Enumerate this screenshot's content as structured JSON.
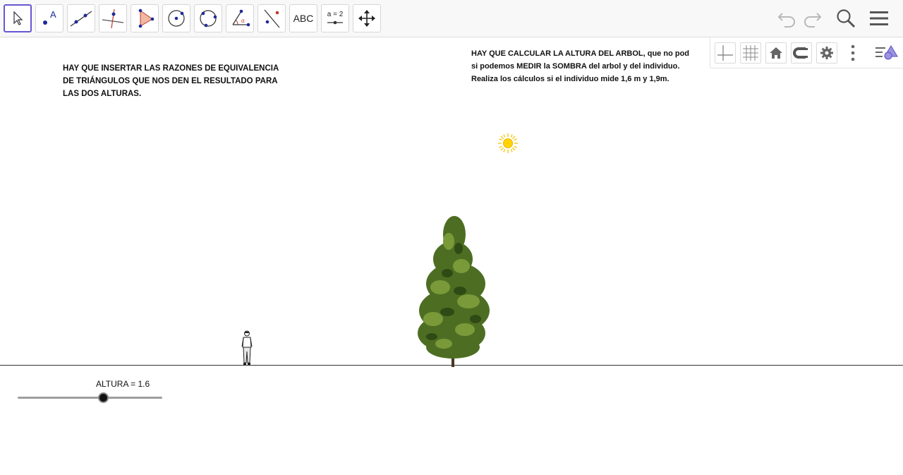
{
  "toolbar": {
    "tools": [
      {
        "name": "move-tool"
      },
      {
        "name": "point-tool"
      },
      {
        "name": "line-tool"
      },
      {
        "name": "perpendicular-line-tool"
      },
      {
        "name": "polygon-tool"
      },
      {
        "name": "circle-center-point-tool"
      },
      {
        "name": "circle-three-points-tool"
      },
      {
        "name": "angle-tool"
      },
      {
        "name": "reflect-tool"
      },
      {
        "name": "text-tool",
        "label": "ABC"
      },
      {
        "name": "slider-tool",
        "label": "a = 2"
      },
      {
        "name": "move-graphics-view-tool"
      }
    ],
    "right_icons": [
      "undo-icon",
      "redo-icon",
      "search-icon",
      "menu-icon"
    ]
  },
  "style_bar": {
    "icons": [
      "axes-icon",
      "grid-icon",
      "home-icon",
      "snap-icon",
      "settings-icon",
      "more-icon",
      "algebra-view-icon"
    ]
  },
  "graphics": {
    "note_left": {
      "lines": [
        "HAY QUE INSERTAR LAS RAZONES DE EQUIVALENCIA",
        "DE TRIÁNGULOS QUE NOS DEN EL RESULTADO PARA",
        "LAS DOS ALTURAS."
      ]
    },
    "note_right": {
      "lines": [
        "HAY QUE CALCULAR LA ALTURA DEL ARBOL, que no pod",
        "si podemos MEDIR la SOMBRA del arbol y del individuo.",
        "Realiza los cálculos si el individuo mide 1,6 m y 1,9m."
      ]
    },
    "slider": {
      "label": "ALTURA = 1.6",
      "value": 1.6,
      "position_fraction": 0.59
    },
    "images": [
      "sun-image",
      "tree-image",
      "person-image"
    ]
  },
  "colors": {
    "accent": "#6557d2",
    "point_blue": "#1e2a9a",
    "sun_yellow": "#ffd400"
  }
}
